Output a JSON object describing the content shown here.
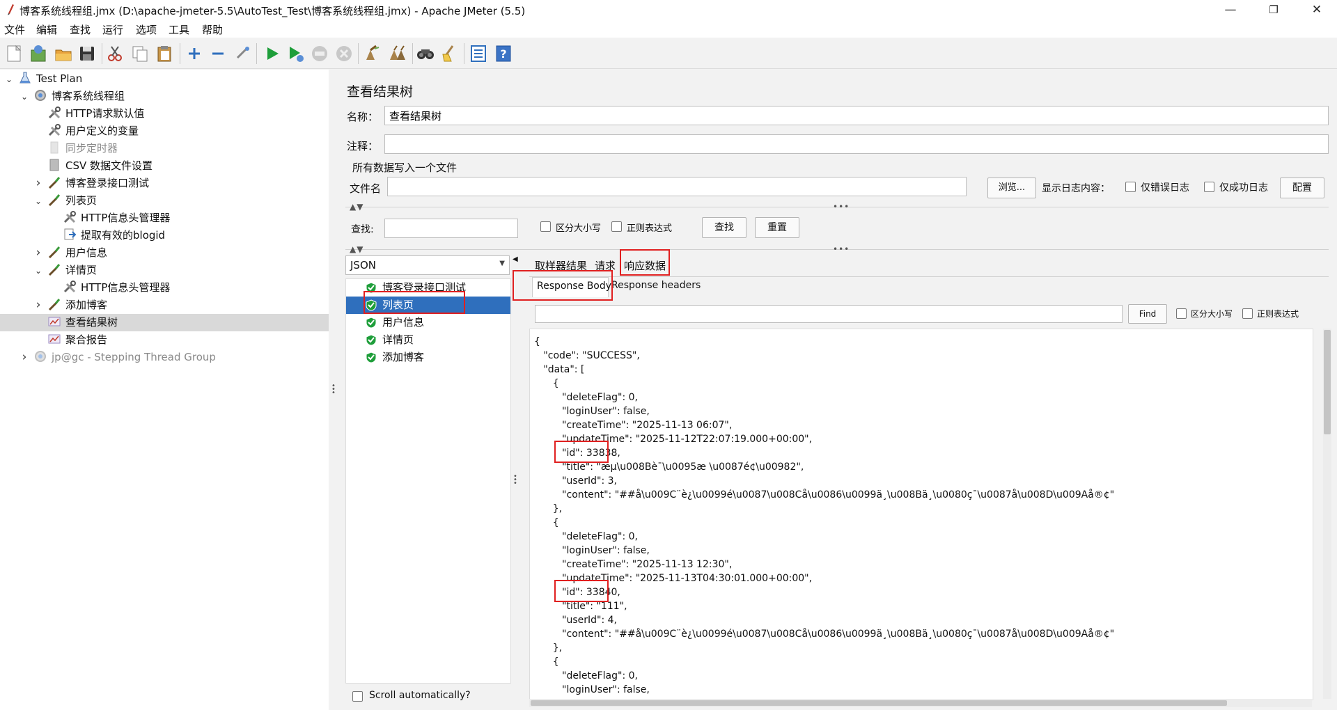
{
  "window": {
    "title": "博客系统线程组.jmx (D:\\apache-jmeter-5.5\\AutoTest_Test\\博客系统线程组.jmx) - Apache JMeter (5.5)",
    "minimize": "—",
    "restore": "❐",
    "close": "✕"
  },
  "menu": [
    "文件",
    "编辑",
    "查找",
    "运行",
    "选项",
    "工具",
    "帮助"
  ],
  "toolbar_icons": [
    "new-icon",
    "templates-icon",
    "open-icon",
    "save-icon",
    "cut-icon",
    "copy-icon",
    "paste-icon",
    "expand-icon",
    "collapse-icon",
    "toggle-icon",
    "start-icon",
    "start-no-pause-icon",
    "stop-icon",
    "shutdown-icon",
    "clear-icon",
    "clear-all-icon",
    "search-icon",
    "reset-search-icon",
    "function-helper-icon",
    "help-icon"
  ],
  "tree": [
    {
      "label": "Test Plan",
      "level": 0,
      "toggle": "expanded",
      "icon": "flask-icon"
    },
    {
      "label": "博客系统线程组",
      "level": 1,
      "toggle": "expanded",
      "icon": "gear-icon"
    },
    {
      "label": "HTTP请求默认值",
      "level": 2,
      "toggle": "none",
      "icon": "wrench-icon"
    },
    {
      "label": "用户定义的变量",
      "level": 2,
      "toggle": "none",
      "icon": "wrench-icon"
    },
    {
      "label": "同步定时器",
      "level": 2,
      "toggle": "none",
      "icon": "timer-icon",
      "disabled": true
    },
    {
      "label": "CSV 数据文件设置",
      "level": 2,
      "toggle": "none",
      "icon": "csv-icon"
    },
    {
      "label": "博客登录接口测试",
      "level": 2,
      "toggle": "collapsed",
      "icon": "sampler-icon"
    },
    {
      "label": "列表页",
      "level": 2,
      "toggle": "expanded",
      "icon": "sampler-icon"
    },
    {
      "label": "HTTP信息头管理器",
      "level": 3,
      "toggle": "none",
      "icon": "wrench-icon"
    },
    {
      "label": "提取有效的blogid",
      "level": 3,
      "toggle": "none",
      "icon": "extractor-icon"
    },
    {
      "label": "用户信息",
      "level": 2,
      "toggle": "collapsed",
      "icon": "sampler-icon"
    },
    {
      "label": "详情页",
      "level": 2,
      "toggle": "expanded",
      "icon": "sampler-icon"
    },
    {
      "label": "HTTP信息头管理器",
      "level": 3,
      "toggle": "none",
      "icon": "wrench-icon"
    },
    {
      "label": "添加博客",
      "level": 2,
      "toggle": "collapsed",
      "icon": "sampler-icon"
    },
    {
      "label": "查看结果树",
      "level": 2,
      "toggle": "none",
      "icon": "listener-icon",
      "selected": true
    },
    {
      "label": "聚合报告",
      "level": 2,
      "toggle": "none",
      "icon": "listener-icon"
    },
    {
      "label": "jp@gc - Stepping Thread Group",
      "level": 1,
      "toggle": "collapsed",
      "icon": "gear-icon",
      "disabled": true
    }
  ],
  "panel": {
    "heading": "查看结果树",
    "name_label": "名称：",
    "name_value": "查看结果树",
    "comment_label": "注释：",
    "comment_value": "",
    "file_section": "所有数据写入一个文件",
    "filename_label": "文件名",
    "filename_value": "",
    "browse": "浏览...",
    "log_label": "显示日志内容：",
    "errors_only": "仅错误日志",
    "success_only": "仅成功日志",
    "configure": "配置",
    "search_label": "查找:",
    "case_sensitive": "区分大小写",
    "regex": "正则表达式",
    "find_btn": "查找",
    "reset_btn": "重置",
    "renderer": "JSON",
    "tabs": [
      "取样器结果",
      "请求",
      "响应数据"
    ],
    "subtabs": [
      "Response Body",
      "Response headers"
    ],
    "find_small": "Find",
    "case_sensitive2": "区分大小写",
    "regex2": "正则表达式",
    "scroll_auto": "Scroll automatically?"
  },
  "results": [
    {
      "label": "博客登录接口测试",
      "selected": false
    },
    {
      "label": "列表页",
      "selected": true
    },
    {
      "label": "用户信息",
      "selected": false
    },
    {
      "label": "详情页",
      "selected": false
    },
    {
      "label": "添加博客",
      "selected": false
    }
  ],
  "response_lines": [
    "{",
    "   \"code\": \"SUCCESS\",",
    "   \"data\": [",
    "      {",
    "         \"deleteFlag\": 0,",
    "         \"loginUser\": false,",
    "         \"createTime\": \"2025-11-13 06:07\",",
    "         \"updateTime\": \"2025-11-12T22:07:19.000+00:00\",",
    "         \"id\": 33838,",
    "         \"title\": \"æµ\\u008Bè¯\\u0095æ \\u0087é¢\\u00982\",",
    "         \"userId\": 3,",
    "         \"content\": \"##å\\u009C¨è¿\\u0099é\\u0087\\u008Cå\\u0086\\u0099ä¸\\u008Bä¸\\u0080ç¯\\u0087å\\u008D\\u009Aå®¢\"",
    "      },",
    "      {",
    "         \"deleteFlag\": 0,",
    "         \"loginUser\": false,",
    "         \"createTime\": \"2025-11-13 12:30\",",
    "         \"updateTime\": \"2025-11-13T04:30:01.000+00:00\",",
    "         \"id\": 33840,",
    "         \"title\": \"111\",",
    "         \"userId\": 4,",
    "         \"content\": \"##å\\u009C¨è¿\\u0099é\\u0087\\u008Cå\\u0086\\u0099ä¸\\u008Bä¸\\u0080ç¯\\u0087å\\u008D\\u009Aå®¢\"",
    "      },",
    "      {",
    "         \"deleteFlag\": 0,",
    "         \"loginUser\": false,"
  ],
  "colors": {
    "highlight": "#e02020",
    "selection": "#2f6fbd"
  }
}
